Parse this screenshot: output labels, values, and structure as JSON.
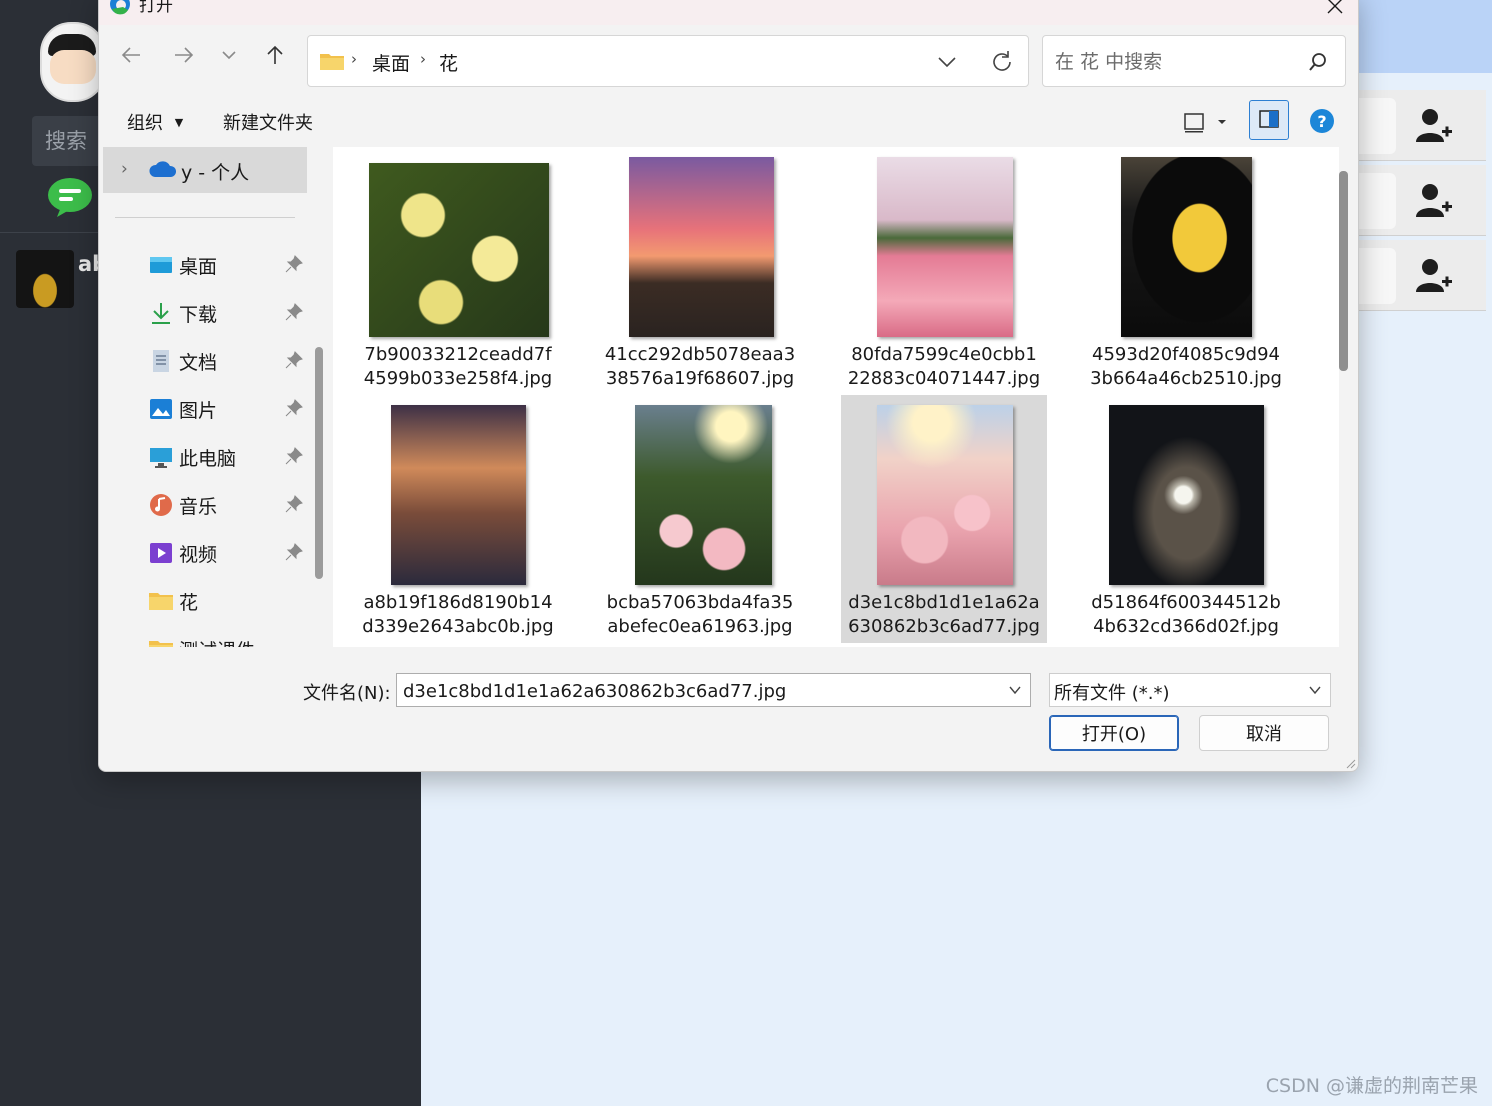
{
  "background_app": {
    "search_label": "搜索",
    "contact_name": "ab",
    "watermark": "CSDN @谦虚的荆南芒果",
    "colors": {
      "sidebar": "#2b2f36",
      "topbar": "#bad3f7",
      "main": "#e6f0fb",
      "chat_icon": "#3cbd4a"
    }
  },
  "dialog": {
    "title": "打开",
    "breadcrumb": [
      "桌面",
      "花"
    ],
    "search_placeholder": "在 花 中搜索",
    "toolbar": {
      "organize": "组织",
      "new_folder": "新建文件夹"
    },
    "nav": {
      "onedrive": "y - 个人",
      "items": [
        {
          "label": "桌面",
          "icon": "desktop-icon",
          "pinned": true
        },
        {
          "label": "下载",
          "icon": "download-icon",
          "pinned": true
        },
        {
          "label": "文档",
          "icon": "document-icon",
          "pinned": true
        },
        {
          "label": "图片",
          "icon": "pictures-icon",
          "pinned": true
        },
        {
          "label": "此电脑",
          "icon": "this-pc-icon",
          "pinned": true
        },
        {
          "label": "音乐",
          "icon": "music-icon",
          "pinned": true
        },
        {
          "label": "视频",
          "icon": "video-icon",
          "pinned": true
        },
        {
          "label": "花",
          "icon": "folder-icon",
          "pinned": false
        },
        {
          "label": "测试课件",
          "icon": "folder-icon",
          "pinned": false
        }
      ]
    },
    "files": [
      {
        "name": "7b90033212ceadd7f4599b033e258f4.jpg",
        "name_lines": [
          "7b90033212ceadd7f",
          "4599b033e258f4.jpg"
        ],
        "selected": false
      },
      {
        "name": "41cc292db5078eaa338576a19f68607.jpg",
        "name_lines": [
          "41cc292db5078eaa3",
          "38576a19f68607.jpg"
        ],
        "selected": false
      },
      {
        "name": "80fda7599c4e0cbb122883c04071447.jpg",
        "name_lines": [
          "80fda7599c4e0cbb1",
          "22883c04071447.jpg"
        ],
        "selected": false
      },
      {
        "name": "4593d20f4085c9d943b664a46cb2510.jpg",
        "name_lines": [
          "4593d20f4085c9d94",
          "3b664a46cb2510.jpg"
        ],
        "selected": false
      },
      {
        "name": "a8b19f186d8190b14d339e2643abc0b.jpg",
        "name_lines": [
          "a8b19f186d8190b14",
          "d339e2643abc0b.jpg"
        ],
        "selected": false
      },
      {
        "name": "bcba57063bda4fa35abefec0ea61963.jpg",
        "name_lines": [
          "bcba57063bda4fa35",
          "abefec0ea61963.jpg"
        ],
        "selected": false
      },
      {
        "name": "d3e1c8bd1d1e1a62a630862b3c6ad77.jpg",
        "name_lines": [
          "d3e1c8bd1d1e1a62a",
          "630862b3c6ad77.jpg"
        ],
        "selected": true
      },
      {
        "name": "d51864f600344512b4b632cd366d02f.jpg",
        "name_lines": [
          "d51864f600344512b",
          "4b632cd366d02f.jpg"
        ],
        "selected": false
      }
    ],
    "filename_label": "文件名(N):",
    "filename_value": "d3e1c8bd1d1e1a62a630862b3c6ad77.jpg",
    "filetype_value": "所有文件 (*.*)",
    "open_label": "打开(O)",
    "cancel_label": "取消"
  }
}
